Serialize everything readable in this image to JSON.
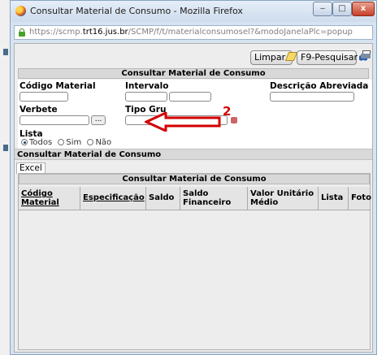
{
  "window": {
    "title": "Consultar Material de Consumo - Mozilla Firefox",
    "url_prefix": "https://scmp.",
    "url_domain": "trt16.jus.br",
    "url_path": "/SCMP/f/t/materialconsumosel?&modoJanelaPlc=popup",
    "min_label": "‒",
    "max_label": "□",
    "close_label": "x"
  },
  "toolbar": {
    "limpar_label": "Limpar",
    "pesquisar_label": "F9-Pesquisar"
  },
  "form": {
    "header": "Consultar Material de Consumo",
    "codigo_label": "Código Material",
    "intervalo_label": "Intervalo",
    "descricao_label": "Descrição Abreviada",
    "verbete_label": "Verbete",
    "verbete_button": "...",
    "tipo_grupo_label": "Tipo Gru",
    "lista_label": "Lista",
    "lista_options": [
      "Todos",
      "Sim",
      "Não"
    ],
    "lista_selected": "Todos"
  },
  "annotation": {
    "number": "2"
  },
  "results": {
    "bar_label": "Consultar Material de Consumo",
    "excel_tab": "Excel",
    "header": "Consultar Material de Consumo",
    "columns": [
      "Código Material",
      "Especificação",
      "Saldo",
      "Saldo Financeiro",
      "Valor Unitário Médio",
      "Lista",
      "Foto"
    ]
  }
}
